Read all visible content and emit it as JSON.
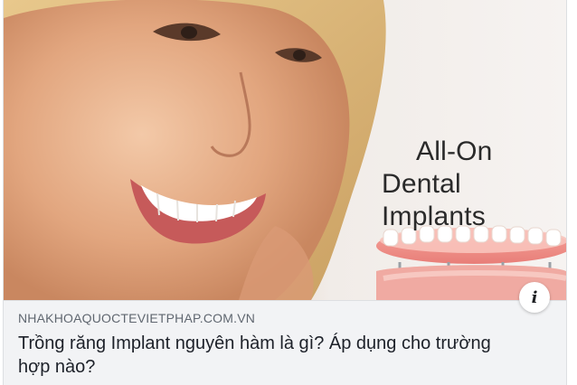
{
  "hero": {
    "caption_line1": "All-On",
    "caption_line2": "Dental Implants"
  },
  "info_button": {
    "label": "i"
  },
  "link_preview": {
    "domain": "NHAKHOAQUOCTEVIETPHAP.COM.VN",
    "title": "Trồng răng Implant nguyên hàm là gì? Áp dụng cho trường hợp nào?"
  },
  "colors": {
    "card_background": "#f2f3f5",
    "domain_text": "#606770",
    "title_text": "#1d2129"
  }
}
